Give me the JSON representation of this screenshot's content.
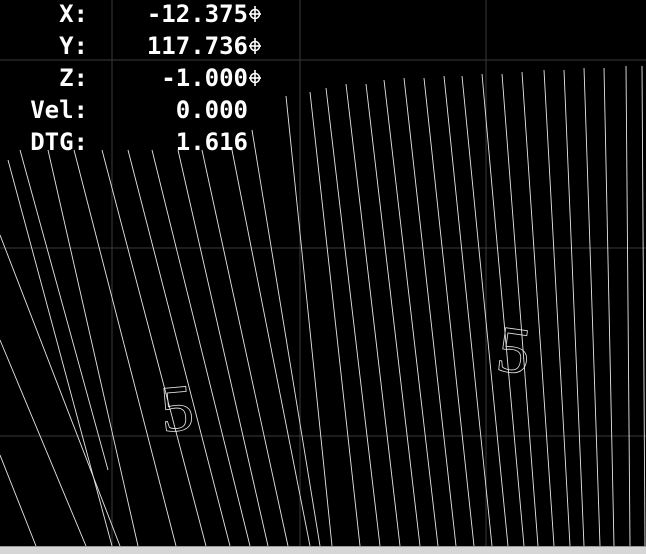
{
  "colors": {
    "background": "#000000",
    "toolpath": "#e6e6e6",
    "grid": "#3a3a3a",
    "scrollbar": "#d6d6d6"
  },
  "dro": {
    "rows": [
      {
        "label": "X:",
        "value": "-12.375",
        "marker": true
      },
      {
        "label": "Y:",
        "value": "117.736",
        "marker": true
      },
      {
        "label": "Z:",
        "value": "-1.000",
        "marker": true
      },
      {
        "label": "Vel:",
        "value": "0.000",
        "marker": false
      },
      {
        "label": "DTG:",
        "value": "1.616",
        "marker": false
      }
    ]
  },
  "preview": {
    "text_glyphs": [
      "5",
      "5"
    ]
  }
}
